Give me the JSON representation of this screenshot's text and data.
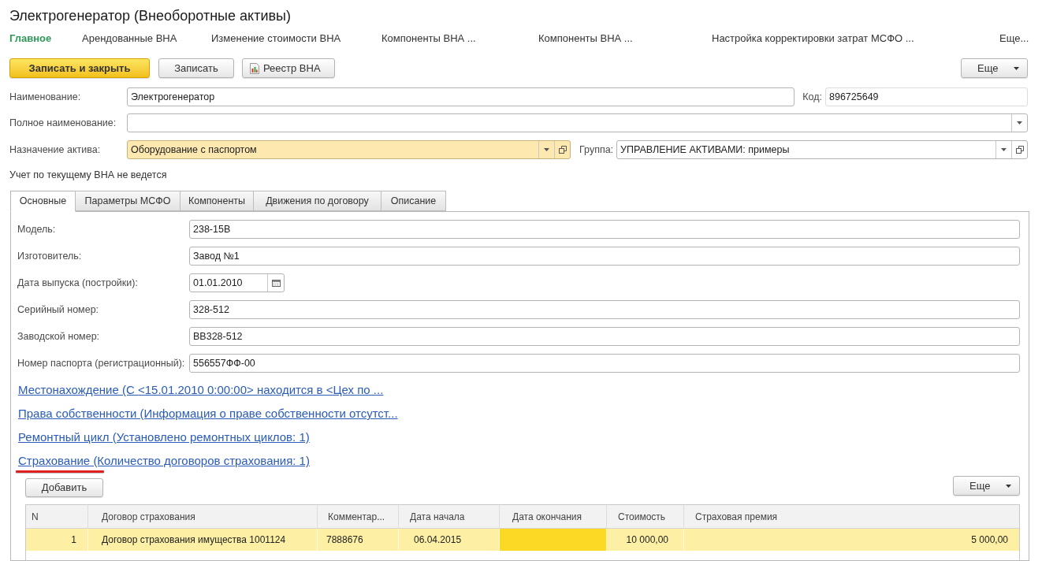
{
  "window": {
    "title": "Электрогенератор (Внеоборотные активы)"
  },
  "nav": [
    {
      "label": "Главное",
      "selected": true
    },
    {
      "label": "Арендованные ВНА",
      "selected": false
    },
    {
      "label": "Изменение стоимости ВНА",
      "selected": false
    },
    {
      "label": "Компоненты ВНА ...",
      "selected": false
    },
    {
      "label": "Компоненты ВНА ...",
      "selected": false
    },
    {
      "label": "Настройка корректировки затрат МСФО ...",
      "selected": false
    },
    {
      "label": "Еще...",
      "selected": false
    }
  ],
  "toolbar": {
    "buttons": [
      {
        "label": "Записать и закрыть",
        "kind": "primary"
      },
      {
        "label": "Записать",
        "kind": "plain"
      },
      {
        "label": "Реестр ВНА",
        "kind": "report"
      }
    ],
    "more_button": "Еще"
  },
  "header": {
    "name": {
      "label": "Наименование:",
      "value": "Электрогенератор"
    },
    "code": {
      "label": "Код:",
      "value": "896725649",
      "readonly": true
    },
    "full_name": {
      "label": "Полное наименование:"
    },
    "purpose": {
      "label": "Назначение актива:",
      "value": "Оборудование с паспортом",
      "highlighted": true
    },
    "group": {
      "label": "Группа:",
      "value": "УПРАВЛЕНИЕ АКТИВАМИ: примеры",
      "highlighted": false
    },
    "note": "Учет по текущему ВНА не ведется"
  },
  "tabs": [
    {
      "label": "Основные",
      "selected": true
    },
    {
      "label": "Параметры МСФО",
      "selected": false
    },
    {
      "label": "Компоненты",
      "selected": false
    },
    {
      "label": "Движения по договору",
      "selected": false
    },
    {
      "label": "Описание",
      "selected": false
    }
  ],
  "fields": [
    {
      "label": "Модель:",
      "value": "238-15В",
      "kind": "text"
    },
    {
      "label": "Изготовитель:",
      "value": "Завод №1",
      "kind": "text"
    },
    {
      "label": "Дата выпуска (постройки):",
      "value": "01.01.2010",
      "kind": "date"
    },
    {
      "label": "Серийный номер:",
      "value": "328-512",
      "kind": "text"
    },
    {
      "label": "Заводской номер:",
      "value": "ВВ328-512",
      "kind": "text"
    },
    {
      "label": "Номер паспорта (регистрационный):",
      "value": "556557ФФ-00",
      "kind": "text"
    }
  ],
  "links": [
    {
      "text": "Местонахождение (С <15.01.2010 0:00:00> находится в <Цех по ...",
      "annotated": false
    },
    {
      "text": "Права собственности (Информация о праве собственности отсутст...",
      "annotated": false
    },
    {
      "text": "Ремонтный цикл (Установлено ремонтных циклов: 1)",
      "annotated": false
    },
    {
      "text": "Страхование (Количество договоров страхования: 1)",
      "annotated": true
    }
  ],
  "insurance": {
    "add_button": "Добавить",
    "more_button": "Еще",
    "columns": [
      "N",
      "Договор страхования",
      "Комментар...",
      "Дата начала",
      "Дата окончания",
      "Стоимость",
      "Страховая премия"
    ],
    "rows": [
      {
        "selected": true,
        "cells": [
          {
            "text": "1",
            "current": false
          },
          {
            "text": "Договор страхования имущества 1001124",
            "current": false
          },
          {
            "text": "7888676",
            "current": false
          },
          {
            "text": "06.04.2015",
            "current": false
          },
          {
            "current": true
          },
          {
            "text": "10 000,00",
            "current": false
          },
          {
            "text": "5 000,00",
            "current": false
          }
        ]
      }
    ]
  }
}
